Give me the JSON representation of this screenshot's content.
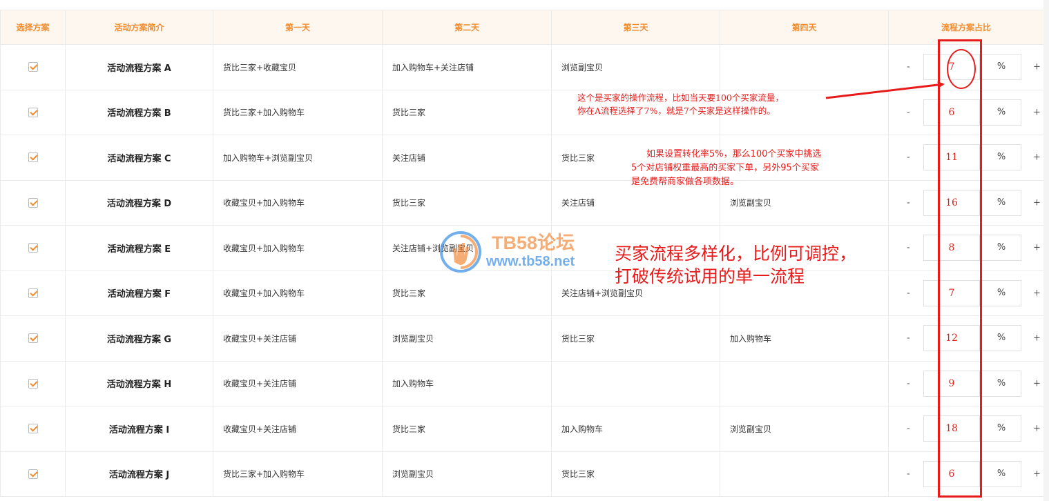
{
  "table": {
    "headers": [
      "选择方案",
      "活动方案简介",
      "第一天",
      "第二天",
      "第三天",
      "第四天",
      "流程方案占比"
    ],
    "rows": [
      {
        "name": "活动流程方案 A",
        "d1": "货比三家+收藏宝贝",
        "d2": "加入购物车+关注店铺",
        "d3": "浏览副宝贝",
        "d4": "",
        "ratio": "7"
      },
      {
        "name": "活动流程方案 B",
        "d1": "货比三家+加入购物车",
        "d2": "货比三家",
        "d3": "",
        "d4": "",
        "ratio": "6"
      },
      {
        "name": "活动流程方案 C",
        "d1": "加入购物车+浏览副宝贝",
        "d2": "关注店铺",
        "d3": "货比三家",
        "d4": "",
        "ratio": "11"
      },
      {
        "name": "活动流程方案 D",
        "d1": "收藏宝贝+加入购物车",
        "d2": "货比三家",
        "d3": "关注店铺",
        "d4": "浏览副宝贝",
        "ratio": "16"
      },
      {
        "name": "活动流程方案 E",
        "d1": "收藏宝贝+加入购物车",
        "d2": "关注店铺+浏览副宝贝",
        "d3": "",
        "d4": "",
        "ratio": "8"
      },
      {
        "name": "活动流程方案 F",
        "d1": "收藏宝贝+加入购物车",
        "d2": "货比三家",
        "d3": "关注店铺+浏览副宝贝",
        "d4": "",
        "ratio": "7"
      },
      {
        "name": "活动流程方案 G",
        "d1": "收藏宝贝+关注店铺",
        "d2": "浏览副宝贝",
        "d3": "货比三家",
        "d4": "加入购物车",
        "ratio": "12"
      },
      {
        "name": "活动流程方案 H",
        "d1": "收藏宝贝+关注店铺",
        "d2": "加入购物车",
        "d3": "",
        "d4": "",
        "ratio": "9"
      },
      {
        "name": "活动流程方案 I",
        "d1": "收藏宝贝+关注店铺",
        "d2": "货比三家",
        "d3": "加入购物车",
        "d4": "浏览副宝贝",
        "ratio": "18"
      },
      {
        "name": "活动流程方案 J",
        "d1": "货比三家+加入购物车",
        "d2": "浏览副宝贝",
        "d3": "货比三家",
        "d4": "",
        "ratio": "6"
      }
    ],
    "minus_label": "-",
    "plus_label": "+",
    "unit_label": "%"
  },
  "annotations": {
    "note1_line1": "这个是买家的操作流程，比如当天要100个买家流量，",
    "note1_line2": "你在A流程选择了7%，就是7个买家是这样操作的。",
    "note2_line1": "如果设置转化率5%，那么100个买家中挑选",
    "note2_line2": "5个对店铺权重最高的买家下单，另外95个买家",
    "note2_line3": "是免费帮商家做各项数据。",
    "note3_line1": "买家流程多样化，比例可调控，",
    "note3_line2": "打破传统试用的单一流程"
  },
  "watermark": {
    "title": "TB58论坛",
    "url": "www.tb58.net"
  },
  "colors": {
    "header_bg": "#fdf7f0",
    "header_text": "#f08c2e",
    "annotation_red": "#e81b1b",
    "ratio_value": "#e0241c"
  }
}
